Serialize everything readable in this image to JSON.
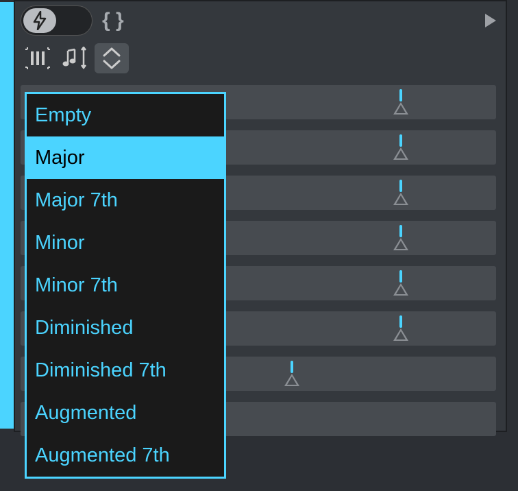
{
  "toolbar": {
    "lightning_icon": "lightning",
    "braces_label": "{ }",
    "play_icon": "play"
  },
  "icons": {
    "piano": "piano-roll",
    "notes": "notes-arrows",
    "updown": "up-down-chevrons"
  },
  "sliders": [
    {
      "position": 80
    },
    {
      "position": 80
    },
    {
      "position": 80
    },
    {
      "position": 80
    },
    {
      "position": 80
    },
    {
      "position": 80
    },
    {
      "position": 57
    },
    {
      "position": 0
    }
  ],
  "dropdown": {
    "selected_index": 1,
    "items": [
      "Empty",
      "Major",
      "Major 7th",
      "Minor",
      "Minor 7th",
      "Diminished",
      "Diminished 7th",
      "Augmented",
      "Augmented 7th"
    ]
  }
}
